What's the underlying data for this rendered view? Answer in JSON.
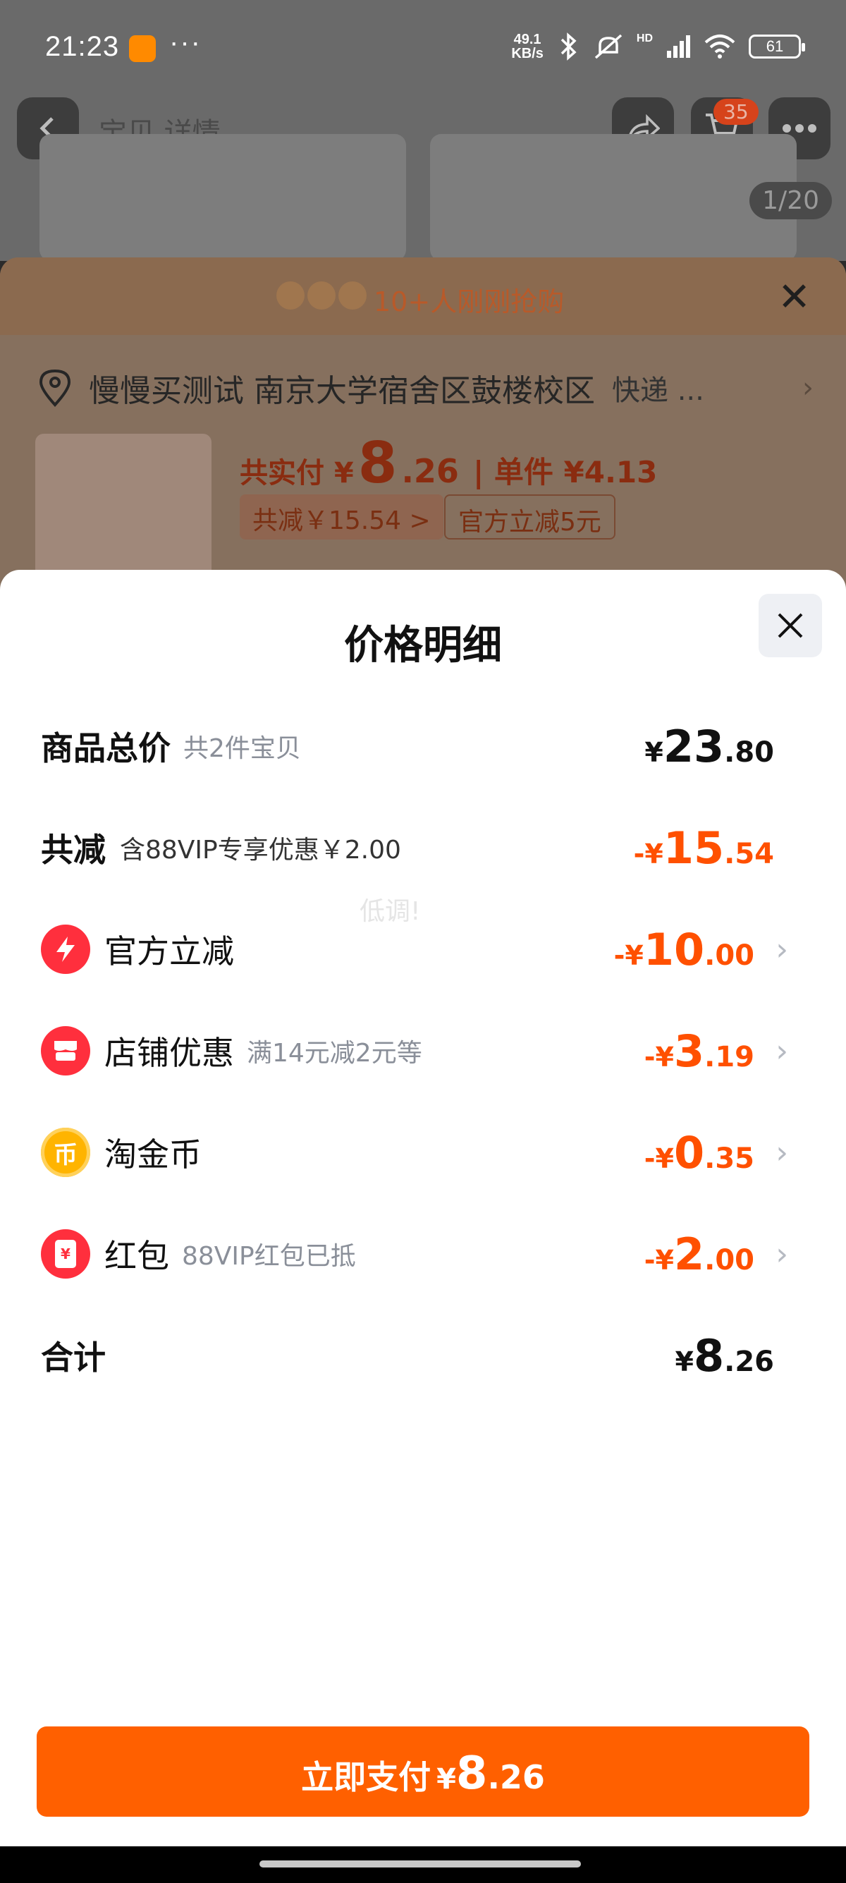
{
  "status_bar": {
    "time": "21:23",
    "dots": "···",
    "net_speed_value": "49.1",
    "net_speed_unit": "KB/s",
    "network": "HD",
    "battery": "61"
  },
  "background": {
    "nav_title": "宝贝 详情",
    "cart_badge": "35",
    "page_indicator": "1/20",
    "banner_text": "10+人刚刚抢购",
    "address": "慢慢买测试 南京大学宿舍区鼓楼校区",
    "delivery": "快递 ...",
    "price_label": "共实付 ¥",
    "price_int": "8",
    "price_dec": ".26",
    "unit_price": "| 单件 ¥4.13",
    "save_tag": "共减￥15.54 >",
    "official_tag": "官方立减5元"
  },
  "sheet": {
    "title": "价格明细",
    "watermark": "低调!",
    "rows": [
      {
        "label": "商品总价",
        "sub": "共2件宝贝",
        "sym": "¥",
        "int": "23",
        "dec": ".80"
      },
      {
        "label": "共减",
        "sub": "含88VIP专享优惠￥2.00",
        "sym": "-¥",
        "int": "15",
        "dec": ".54"
      },
      {
        "label": "官方立减",
        "sub": "",
        "sym": "-¥",
        "int": "10",
        "dec": ".00",
        "icon": "lightning-icon",
        "color": "#ff2f3d"
      },
      {
        "label": "店铺优惠",
        "sub": "满14元减2元等",
        "sym": "-¥",
        "int": "3",
        "dec": ".19",
        "icon": "shop-icon",
        "color": "#ff2f3d"
      },
      {
        "label": "淘金币",
        "sub": "",
        "sym": "-¥",
        "int": "0",
        "dec": ".35",
        "icon": "coin-icon",
        "color": "#ffb400"
      },
      {
        "label": "红包",
        "sub": "88VIP红包已抵",
        "sym": "-¥",
        "int": "2",
        "dec": ".00",
        "icon": "red-packet-icon",
        "color": "#ff2f3d"
      },
      {
        "label": "合计",
        "sub": "",
        "sym": "¥",
        "int": "8",
        "dec": ".26"
      }
    ],
    "coin_glyph": "币",
    "packet_glyph": "¥"
  },
  "pay_button": {
    "text": "立即支付",
    "sym": "¥",
    "int": "8",
    "dec": ".26"
  },
  "colors": {
    "accent": "#ff5000",
    "pay_button": "#ff6000"
  }
}
